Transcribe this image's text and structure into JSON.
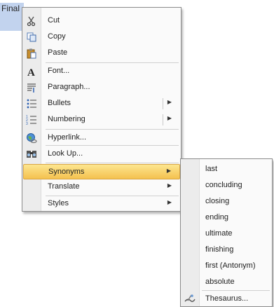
{
  "document": {
    "selected_word": "Final"
  },
  "context_menu": {
    "items": [
      {
        "label": "Cut",
        "icon": "scissors-icon"
      },
      {
        "label": "Copy",
        "icon": "copy-icon"
      },
      {
        "label": "Paste",
        "icon": "clipboard-icon"
      },
      {
        "label": "Font...",
        "icon": "font-icon"
      },
      {
        "label": "Paragraph...",
        "icon": "paragraph-icon"
      },
      {
        "label": "Bullets",
        "icon": "bullets-icon",
        "submenu": true
      },
      {
        "label": "Numbering",
        "icon": "numbering-icon",
        "submenu": true
      },
      {
        "label": "Hyperlink...",
        "icon": "hyperlink-icon"
      },
      {
        "label": "Look Up...",
        "icon": "research-icon"
      },
      {
        "label": "Synonyms",
        "submenu": true,
        "highlighted": true
      },
      {
        "label": "Translate",
        "submenu": true
      },
      {
        "label": "Styles",
        "submenu": true
      }
    ]
  },
  "synonyms_menu": {
    "items": [
      "last",
      "concluding",
      "closing",
      "ending",
      "ultimate",
      "finishing",
      "first (Antonym)",
      "absolute"
    ],
    "thesaurus_label": "Thesaurus...",
    "thesaurus_icon": "thesaurus-icon"
  },
  "colors": {
    "highlight": "#f4c14f",
    "selection": "#c2d3ee"
  }
}
